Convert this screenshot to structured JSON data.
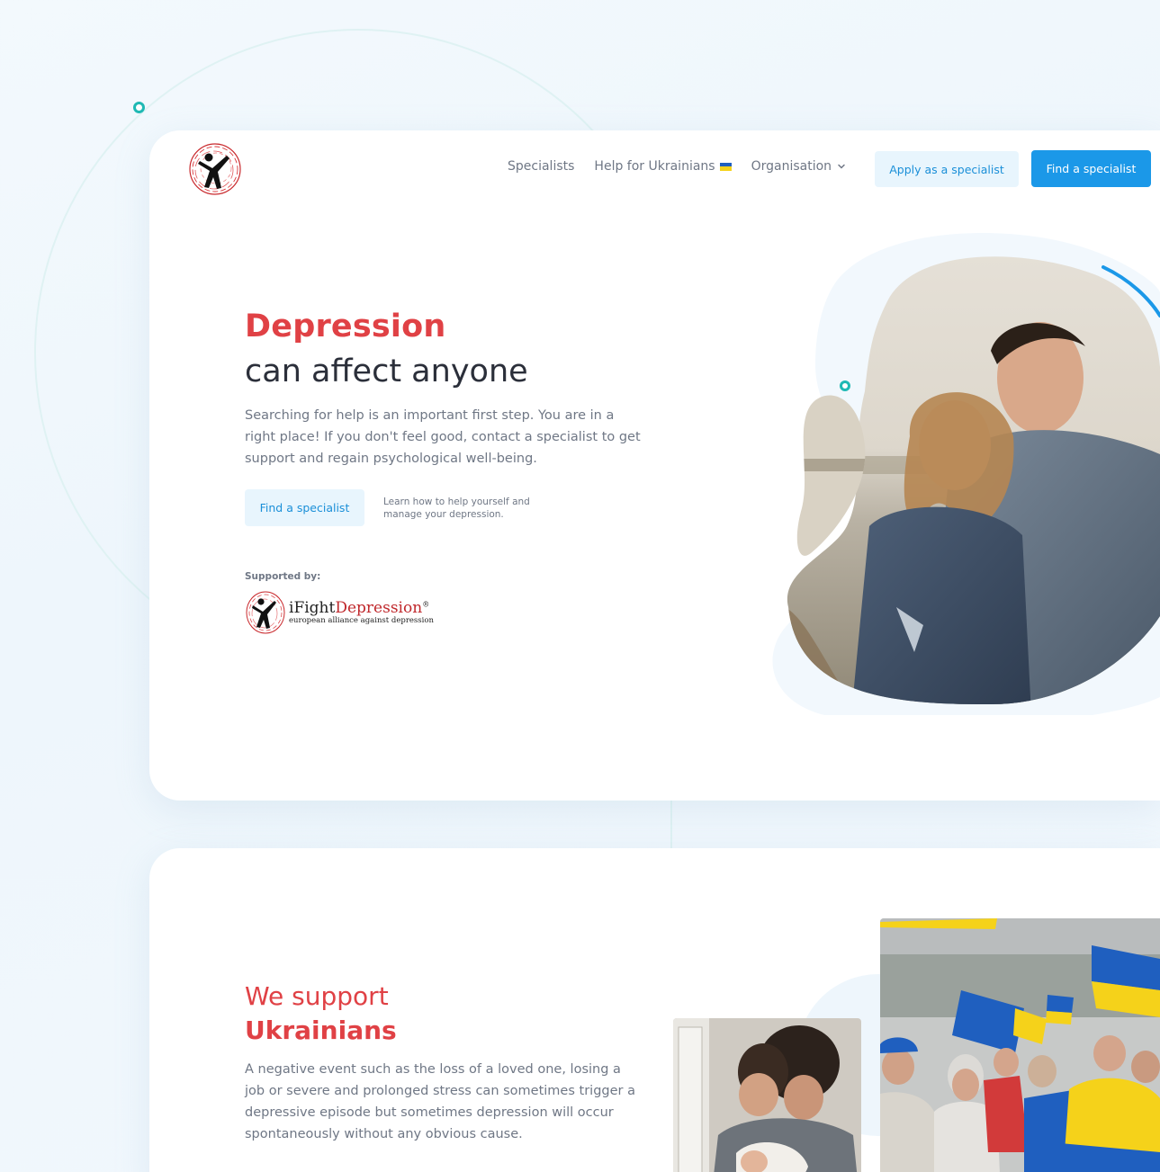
{
  "nav": {
    "items": [
      {
        "label": "Specialists"
      },
      {
        "label": "Help for Ukrainians"
      },
      {
        "label": "Organisation"
      }
    ],
    "apply_button": "Apply as a specialist",
    "find_button": "Find a specialist"
  },
  "hero": {
    "title_highlight": "Depression",
    "title_rest": "can affect anyone",
    "description": "Searching for help is an important first step. You are in a right place! If you don't feel good, contact a specialist to get support and regain psychological well-being.",
    "cta_button": "Find a specialist",
    "cta_note": "Learn how to help yourself and manage your depression.",
    "supported_by_label": "Supported by:",
    "supporter": {
      "name_i": "i",
      "name_fight": "Fight",
      "name_depression": "Depression",
      "registered": "®",
      "tagline": "european alliance against depression"
    }
  },
  "ukraine": {
    "title_line1": "We support",
    "title_line2": "Ukrainians",
    "description": "A negative event such as the loss of a loved one, losing a job or severe and prolonged stress can sometimes trigger a depressive episode but sometimes depression will occur spontaneously without any obvious cause."
  },
  "colors": {
    "accent_red": "#e04145",
    "accent_blue": "#1b98e8",
    "light_blue": "#e8f5fd",
    "teal_dot": "#1fb9b4",
    "ukraine_blue": "#1f5fbf",
    "ukraine_yellow": "#f5d21a"
  },
  "icons": {
    "logo": "ifightdepression-figure-logo",
    "flag": "ukraine-flag-icon",
    "dropdown": "chevron-down-icon"
  }
}
